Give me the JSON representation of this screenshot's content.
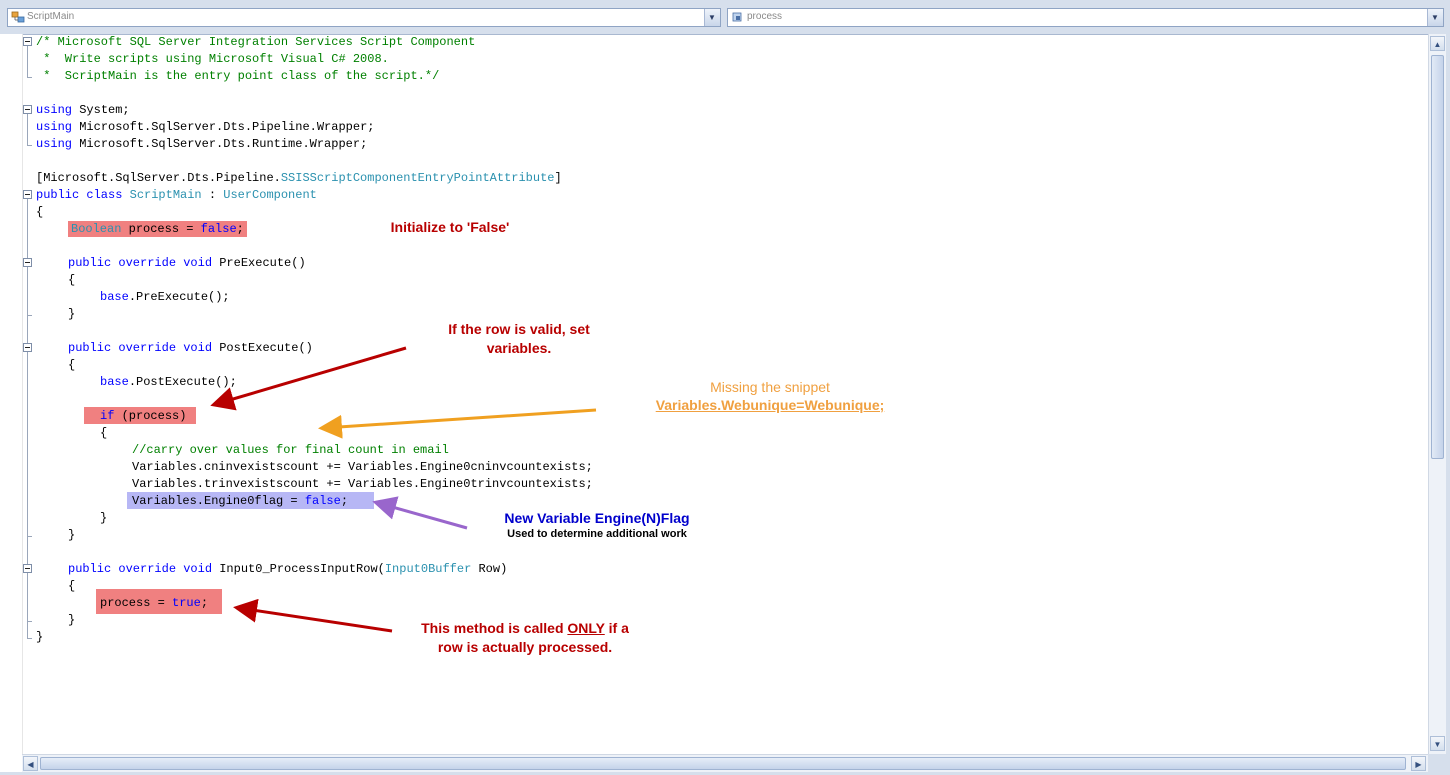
{
  "toolbar": {
    "class_dropdown": {
      "value": "ScriptMain",
      "icon": "class-icon"
    },
    "member_dropdown": {
      "value": "process",
      "icon": "member-icon"
    }
  },
  "code": {
    "l1": "/* Microsoft SQL Server Integration Services Script Component",
    "l2": " *  Write scripts using Microsoft Visual C# 2008.",
    "l3": " *  ScriptMain is the entry point class of the script.*/",
    "using_kw": "using",
    "u1": " System;",
    "u2": " Microsoft.SqlServer.Dts.Pipeline.Wrapper;",
    "u3": " Microsoft.SqlServer.Dts.Runtime.Wrapper;",
    "attr_pre": "[Microsoft.SqlServer.Dts.Pipeline.",
    "attr_type": "SSISScriptComponentEntryPointAttribute",
    "attr_post": "]",
    "cls_kw": "public class",
    "cls_name": "ScriptMain",
    "cls_sep": " : ",
    "cls_base": "UserComponent",
    "open_brace": "{",
    "close_brace": "}",
    "bool_type": "Boolean",
    "bool_mid": " process = ",
    "false_kw": "false",
    "semi": ";",
    "pov_kw": "public override void",
    "pre_sig": " PreExecute()",
    "base_kw": "base",
    "pre_call": ".PreExecute();",
    "post_sig": " PostExecute()",
    "post_call": ".PostExecute();",
    "if_kw": "if",
    "if_cond": " (process)",
    "comment_carry": "//carry over values for final count in email",
    "v1": "Variables.cninvexistscount += Variables.Engine0cninvcountexists;",
    "v2": "Variables.trinvexistscount += Variables.Engine0trinvcountexists;",
    "v3_pre": "Variables.Engine0flag = ",
    "input_sig_pre": " Input0_ProcessInputRow(",
    "input_type": "Input0Buffer",
    "input_sig_post": " Row)",
    "proc_pre": "process = ",
    "true_kw": "true"
  },
  "annotations": {
    "init": "Initialize to 'False'",
    "valid_line1": "If the row is valid, set",
    "valid_line2": "variables.",
    "missing_line1": "Missing the snippet",
    "missing_line2": "Variables.Webunique=Webunique;",
    "newvar_line1": "New Variable Engine(N)Flag",
    "newvar_line2": "Used to determine additional work",
    "method_pre": "This method is called ",
    "method_only": "ONLY",
    "method_post": " if a",
    "method_line2": "row is actually processed."
  },
  "colors": {
    "keyword": "#0000ff",
    "comment": "#008000",
    "type": "#2b91af",
    "highlight_red": "#f08080",
    "highlight_purple": "#b7b7f5",
    "annotation_red": "#b80000",
    "annotation_orange": "#f0a040",
    "annotation_blue": "#0000cc",
    "arrow_purple": "#9966cc"
  }
}
